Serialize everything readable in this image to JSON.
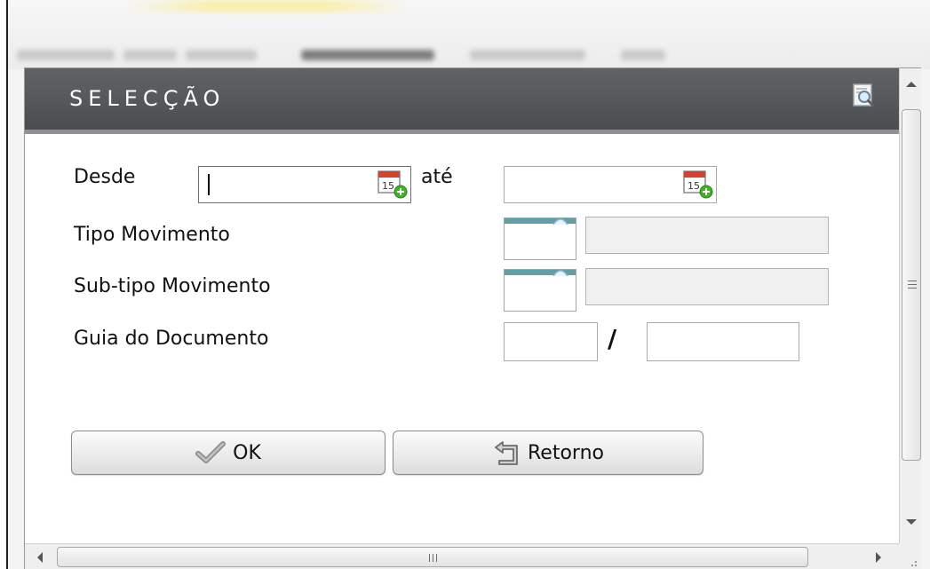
{
  "dialog": {
    "title": "SELECÇÃO"
  },
  "form": {
    "desde_label": "Desde",
    "desde_value": "",
    "ate_label": "até",
    "ate_value": "",
    "calendar_day": "15",
    "tipo_label": "Tipo Movimento",
    "tipo_code": "",
    "tipo_description": "",
    "subtipo_label": "Sub-tipo Movimento",
    "subtipo_code": "",
    "subtipo_description": "",
    "guia_label": "Guia do Documento",
    "guia_separator": "/",
    "guia_part1": "",
    "guia_part2": ""
  },
  "buttons": {
    "ok_label": "OK",
    "retorno_label": "Retorno"
  },
  "icons": {
    "preview": "magnifier-page-icon",
    "calendar": "calendar-add-icon",
    "ok": "checkmark-icon",
    "retorno": "return-arrow-icon"
  },
  "colors": {
    "title_bar": "#55575a",
    "lookup_accent": "#5f9fa6",
    "calendar_red": "#d9402b",
    "calendar_plus": "#43b02a"
  }
}
